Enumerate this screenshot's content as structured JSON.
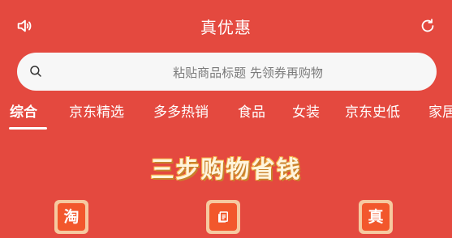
{
  "header": {
    "title": "真优惠",
    "left_icon": "speaker-icon",
    "right_icon": "refresh-icon"
  },
  "search": {
    "placeholder": "粘贴商品标题 先领券再购物",
    "icon": "search-icon"
  },
  "tabs": [
    {
      "label": "综合",
      "active": true
    },
    {
      "label": "京东精选",
      "active": false
    },
    {
      "label": "多多热销",
      "active": false
    },
    {
      "label": "食品",
      "active": false
    },
    {
      "label": "女装",
      "active": false
    },
    {
      "label": "京东史低",
      "active": false
    },
    {
      "label": "家居",
      "active": false
    }
  ],
  "headline": "三步购物省钱",
  "steps": [
    {
      "glyph": "淘",
      "icon": "taobao-icon"
    },
    {
      "glyph": "",
      "icon": "document-icon"
    },
    {
      "glyph": "真",
      "icon": "zhen-icon"
    }
  ],
  "colors": {
    "background": "#e4493f",
    "search_bg": "#f7f7f7",
    "step_fill": "#f2572c",
    "step_border": "#f6c9a0"
  }
}
